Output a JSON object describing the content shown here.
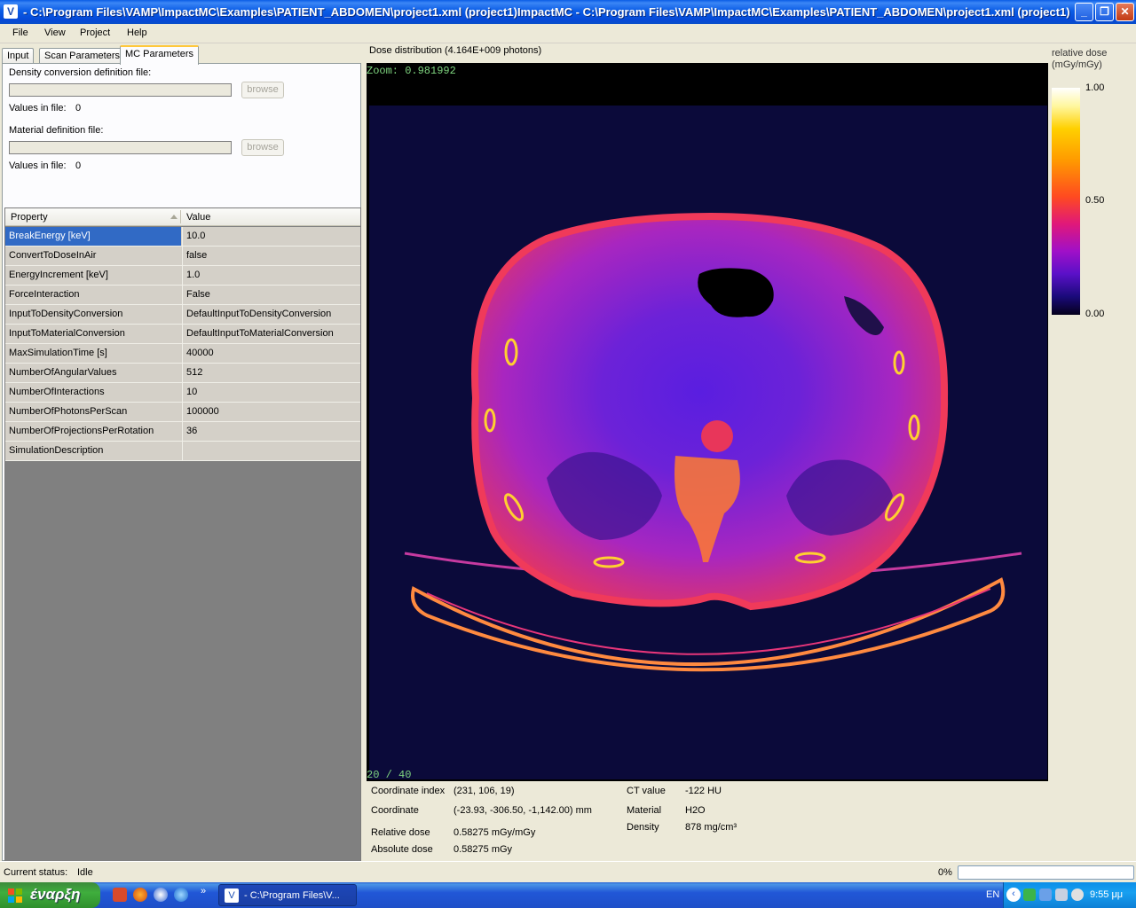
{
  "window": {
    "title": "- C:\\Program Files\\VAMP\\ImpactMC\\Examples\\PATIENT_ABDOMEN\\project1.xml  (project1)ImpactMC - C:\\Program Files\\VAMP\\ImpactMC\\Examples\\PATIENT_ABDOMEN\\project1.xml  (project1)"
  },
  "menu": {
    "file": "File",
    "view": "View",
    "project": "Project",
    "help": "Help"
  },
  "tabs": {
    "input": "Input",
    "scan": "Scan Parameters",
    "mc": "MC Parameters"
  },
  "mc": {
    "density_label": "Density conversion definition file:",
    "density_browse": "browse",
    "density_values_label": "Values in file:",
    "density_values": "0",
    "material_label": "Material definition file:",
    "material_browse": "browse",
    "material_values_label": "Values in file:",
    "material_values": "0"
  },
  "grid": {
    "col_property": "Property",
    "col_value": "Value",
    "rows": [
      {
        "property": "BreakEnergy [keV]",
        "value": "10.0"
      },
      {
        "property": "ConvertToDoseInAir",
        "value": "false"
      },
      {
        "property": "EnergyIncrement [keV]",
        "value": "1.0"
      },
      {
        "property": "ForceInteraction",
        "value": "False"
      },
      {
        "property": "InputToDensityConversion",
        "value": "DefaultInputToDensityConversion"
      },
      {
        "property": "InputToMaterialConversion",
        "value": "DefaultInputToMaterialConversion"
      },
      {
        "property": "MaxSimulationTime [s]",
        "value": "40000"
      },
      {
        "property": "NumberOfAngularValues",
        "value": "512"
      },
      {
        "property": "NumberOfInteractions",
        "value": "10"
      },
      {
        "property": "NumberOfPhotonsPerScan",
        "value": "100000"
      },
      {
        "property": "NumberOfProjectionsPerRotation",
        "value": "36"
      },
      {
        "property": "SimulationDescription",
        "value": ""
      }
    ]
  },
  "viewer": {
    "title": "Dose distribution (4.164E+009 photons)",
    "zoom": "Zoom: 0.981992",
    "slice": "20 / 40"
  },
  "colorbar": {
    "title_line1": "relative dose",
    "title_line2": "(mGy/mGy)",
    "tick_max": "1.00",
    "tick_mid": "0.50",
    "tick_min": "0.00"
  },
  "info": {
    "coord_index_label": "Coordinate index",
    "coord_index": "(231, 106, 19)",
    "coord_label": "Coordinate",
    "coord": "(-23.93, -306.50, -1,142.00) mm",
    "rel_dose_label": "Relative dose",
    "rel_dose": "0.58275 mGy/mGy",
    "abs_dose_label": "Absolute dose",
    "abs_dose": "0.58275 mGy",
    "ct_label": "CT value",
    "ct": "-122 HU",
    "material_label": "Material",
    "material": "H2O",
    "density_label": "Density",
    "density": "878 mg/cm³"
  },
  "status": {
    "label": "Current status:",
    "value": "Idle",
    "progress_text": "0%",
    "progress": 0
  },
  "taskbar": {
    "start": "έναρξη",
    "task_label": "- C:\\Program Files\\V...",
    "lang": "EN",
    "clock": "9:55 μμ"
  }
}
